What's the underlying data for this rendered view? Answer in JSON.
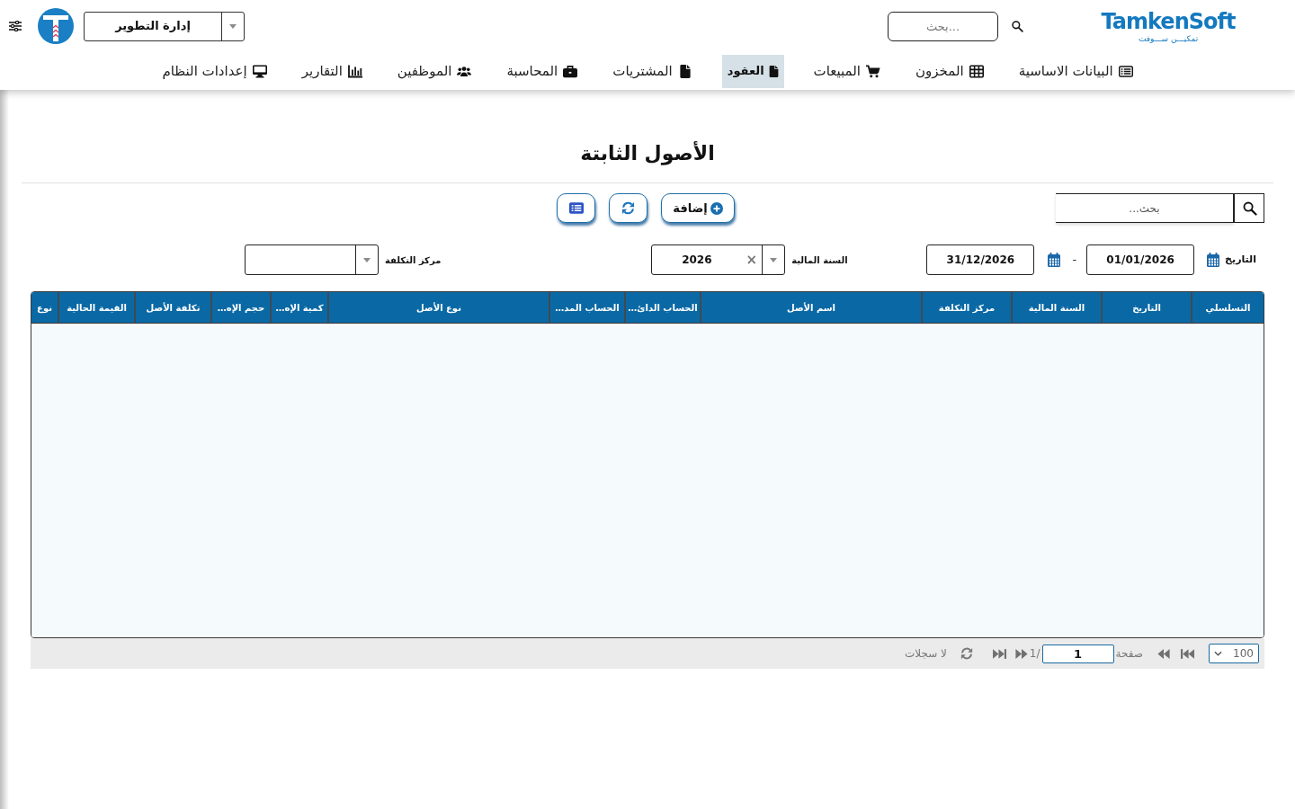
{
  "header": {
    "logo": {
      "name": "TamkenSoft",
      "tagline": "تمكيـــن ســـوفت"
    },
    "search": {
      "placeholder": "بحث..."
    },
    "branch_select": {
      "value": "إدارة التطوير"
    }
  },
  "nav": [
    {
      "label": "البيانات الاساسية",
      "selected": false
    },
    {
      "label": "المخزون",
      "selected": false
    },
    {
      "label": "المبيعات",
      "selected": false
    },
    {
      "label": "العقود",
      "selected": true
    },
    {
      "label": "المشتريات",
      "selected": false
    },
    {
      "label": "المحاسبة",
      "selected": false
    },
    {
      "label": "الموظفين",
      "selected": false
    },
    {
      "label": "التقارير",
      "selected": false
    },
    {
      "label": "إعدادات النظام",
      "selected": false
    }
  ],
  "page_title": "الأصول الثابتة",
  "toolbar": {
    "search": {
      "placeholder": "بحث..."
    },
    "buttons": [
      {
        "kind": "add",
        "label": "إضافة"
      },
      {
        "kind": "refresh"
      },
      {
        "kind": "list"
      }
    ]
  },
  "filters": {
    "date": {
      "label": "التاريخ",
      "from": "01/01/2026",
      "separator": "-",
      "to": "31/12/2026"
    },
    "fiscal_year": {
      "label": "السنة المالية",
      "value": "2026",
      "clear": "×"
    },
    "cost_center": {
      "label": "مركز التكلفة"
    }
  },
  "table": {
    "columns": [
      "التسلسلي",
      "التاريخ",
      "السنة المالية",
      "مركز التكلفة",
      "اسم الأصل",
      "الحساب الدائ…",
      "الحساب المد…",
      "نوع الأصل",
      "كمية الإه…",
      "حجم الإه…",
      "تكلفة الأصل",
      "القيمة الحالية",
      "نوع"
    ]
  },
  "pager": {
    "page_size": "100",
    "page_label": "صفحة",
    "page": "1",
    "page_count": "1/",
    "status": "لا سجلات"
  }
}
